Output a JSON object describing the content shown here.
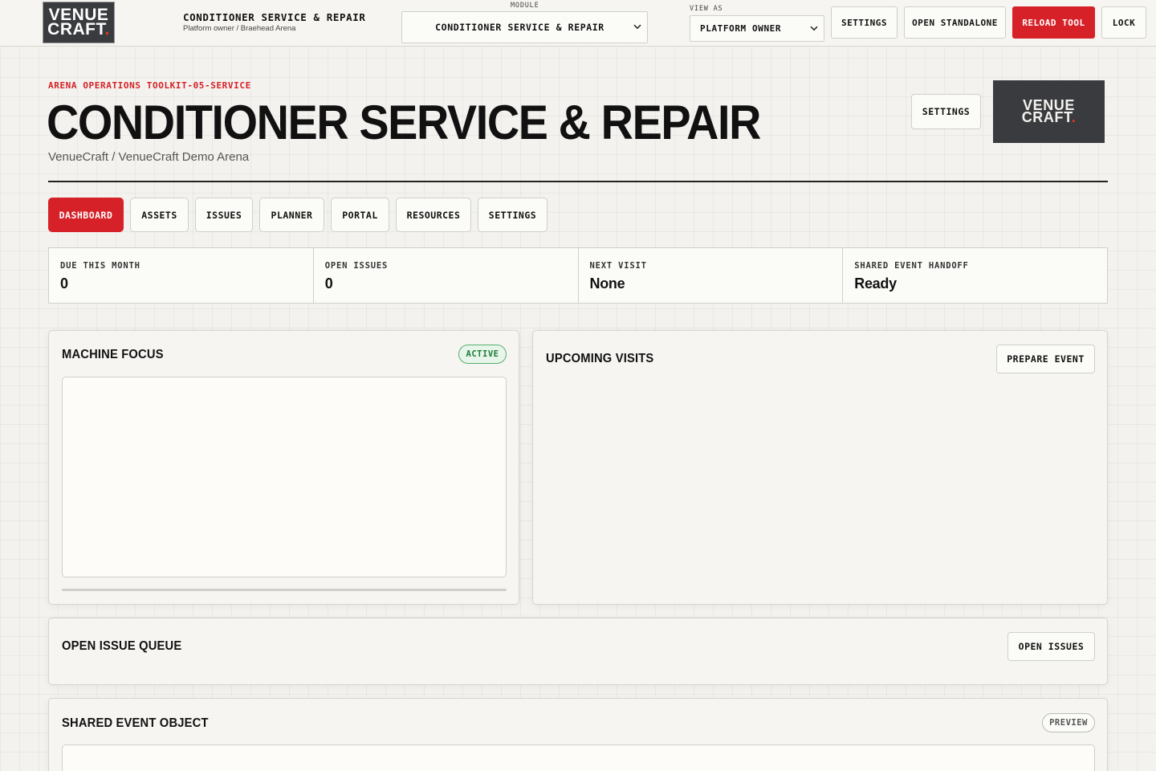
{
  "topbar": {
    "logo": {
      "line1": "VENUE",
      "line2": "CRAFT",
      "dot": "."
    },
    "app_title": "CONDITIONER SERVICE & REPAIR",
    "app_subtitle": "Platform owner / Braehead Arena",
    "module_label": "MODULE",
    "module_value": "CONDITIONER SERVICE & REPAIR",
    "view_as_label": "VIEW AS",
    "view_as_value": "PLATFORM OWNER",
    "buttons": {
      "settings": "SETTINGS",
      "open_standalone": "OPEN STANDALONE",
      "reload_tool": "RELOAD TOOL",
      "lock": "LOCK"
    }
  },
  "header": {
    "eyebrow": "ARENA OPERATIONS TOOLKIT-05-SERVICE",
    "title": "CONDITIONER SERVICE & REPAIR",
    "subtitle": "VenueCraft / VenueCraft Demo Arena",
    "settings_button": "SETTINGS",
    "logo": {
      "line1": "VENUE",
      "line2": "CRAFT",
      "dot": "."
    }
  },
  "tabs": [
    {
      "label": "DASHBOARD",
      "active": true
    },
    {
      "label": "ASSETS",
      "active": false
    },
    {
      "label": "ISSUES",
      "active": false
    },
    {
      "label": "PLANNER",
      "active": false
    },
    {
      "label": "PORTAL",
      "active": false
    },
    {
      "label": "RESOURCES",
      "active": false
    },
    {
      "label": "SETTINGS",
      "active": false
    }
  ],
  "stats": [
    {
      "label": "DUE THIS MONTH",
      "value": "0"
    },
    {
      "label": "OPEN ISSUES",
      "value": "0"
    },
    {
      "label": "NEXT VISIT",
      "value": "None"
    },
    {
      "label": "SHARED EVENT HANDOFF",
      "value": "Ready"
    }
  ],
  "panels": {
    "machine_focus": {
      "title": "MACHINE FOCUS",
      "badge": "ACTIVE"
    },
    "upcoming_visits": {
      "title": "UPCOMING VISITS",
      "button": "PREPARE EVENT"
    },
    "open_issue_queue": {
      "title": "OPEN ISSUE QUEUE",
      "button": "OPEN ISSUES"
    },
    "shared_event_object": {
      "title": "SHARED EVENT OBJECT",
      "badge": "PREVIEW"
    }
  },
  "colors": {
    "accent_red": "#d62128",
    "logo_bg": "#3a3b3f",
    "logo_dot": "#e23a1f",
    "active_green": "#1f7d37"
  },
  "icons": {
    "select_chevron": "chevron-down-icon"
  }
}
